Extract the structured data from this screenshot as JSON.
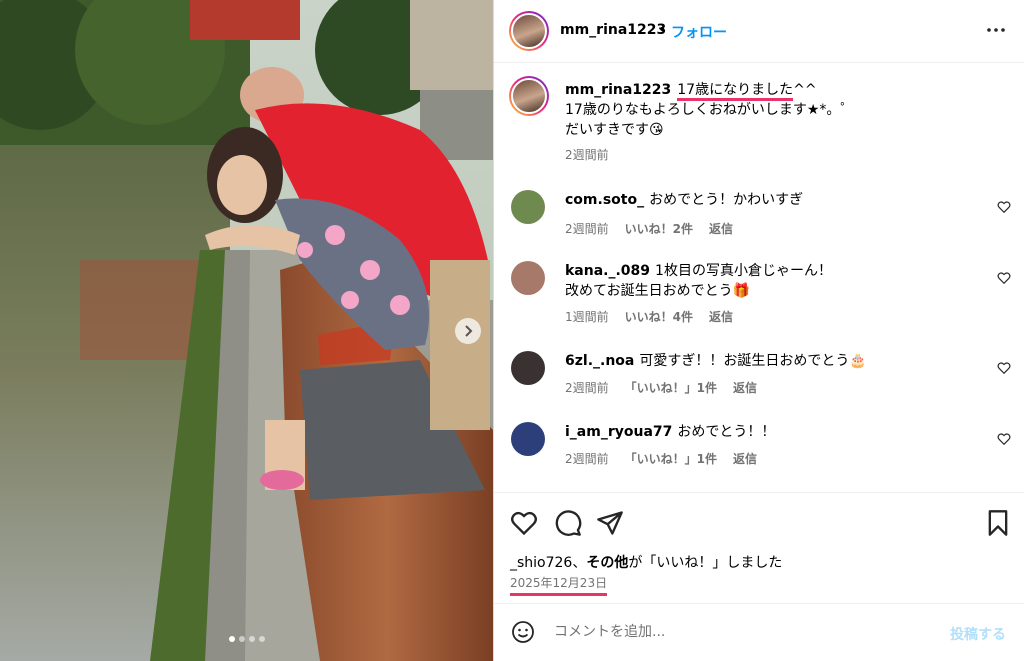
{
  "post": {
    "username": "mm_rina1223",
    "dot": "•",
    "follow_label": "フォロー",
    "caption": {
      "username": "mm_rina1223",
      "highlight": "17歳になりました",
      "line1_rest": "^^",
      "line2": "17歳のりなもよろしくおねがいします★*。゜",
      "line3": "だいすきです😘",
      "time": "2週間前"
    },
    "likes": {
      "user": "_shio726",
      "sep": "、",
      "others": "その他",
      "suffix": "が「いいね！」しました"
    },
    "date": "2025年12月23日"
  },
  "comments": [
    {
      "user": "com.soto_",
      "text": "おめでとう！かわいすぎ",
      "time": "2週間前",
      "likes": "いいね！2件",
      "reply": "返信",
      "avatar_color": "#6f8a4f"
    },
    {
      "user": "kana._.089",
      "text": "1枚目の写真小倉じゃーん！",
      "text2": "改めてお誕生日おめでとう🎁",
      "time": "1週間前",
      "likes": "いいね！4件",
      "reply": "返信",
      "avatar_color": "#a7796b"
    },
    {
      "user": "6zl._.noa",
      "text": "可愛すぎ！！お誕生日おめでとう🎂",
      "time": "2週間前",
      "likes": "「いいね！」1件",
      "reply": "返信",
      "avatar_color": "#3a3230"
    },
    {
      "user": "i_am_ryoua77",
      "text": "おめでとう！！",
      "time": "2週間前",
      "likes": "「いいね！」1件",
      "reply": "返信",
      "avatar_color": "#2c3f7a"
    }
  ],
  "comment_box": {
    "placeholder": "コメントを追加...",
    "post_label": "投稿する"
  },
  "carousel": {
    "slides": 4,
    "current": 1
  },
  "icons": {
    "more": "more-horizontal-icon",
    "like": "heart-icon",
    "comment": "comment-icon",
    "share": "share-icon",
    "save": "bookmark-icon",
    "emoji": "emoji-icon",
    "next": "chevron-right-icon"
  },
  "colors": {
    "accent": "#0095f6",
    "highlight": "#e8336b",
    "muted": "#737373"
  }
}
